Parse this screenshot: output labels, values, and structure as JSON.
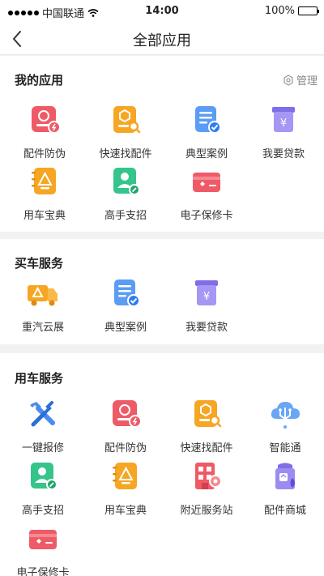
{
  "status_bar": {
    "carrier": "中国联通",
    "time": "14:00",
    "battery": "100%"
  },
  "nav": {
    "title": "全部应用"
  },
  "my_apps": {
    "title": "我的应用",
    "manage_label": "管理",
    "items": [
      {
        "label": "配件防伪",
        "icon": "part-anticounterfeit-icon"
      },
      {
        "label": "快速找配件",
        "icon": "find-parts-icon"
      },
      {
        "label": "典型案例",
        "icon": "cases-icon"
      },
      {
        "label": "我要贷款",
        "icon": "loan-icon"
      },
      {
        "label": "用车宝典",
        "icon": "guide-book-icon"
      },
      {
        "label": "高手支招",
        "icon": "expert-tips-icon"
      },
      {
        "label": "电子保修卡",
        "icon": "warranty-card-icon"
      }
    ]
  },
  "buy_service": {
    "title": "买车服务",
    "items": [
      {
        "label": "重汽云展",
        "icon": "truck-expo-icon"
      },
      {
        "label": "典型案例",
        "icon": "cases-icon"
      },
      {
        "label": "我要贷款",
        "icon": "loan-icon"
      }
    ]
  },
  "use_service": {
    "title": "用车服务",
    "items": [
      {
        "label": "一键报修",
        "icon": "repair-tools-icon"
      },
      {
        "label": "配件防伪",
        "icon": "part-anticounterfeit-icon"
      },
      {
        "label": "快速找配件",
        "icon": "find-parts-icon"
      },
      {
        "label": "智能通",
        "icon": "smart-cloud-icon"
      },
      {
        "label": "高手支招",
        "icon": "expert-tips-icon"
      },
      {
        "label": "用车宝典",
        "icon": "guide-book-icon"
      },
      {
        "label": "附近服务站",
        "icon": "nearby-station-icon"
      },
      {
        "label": "配件商城",
        "icon": "parts-mall-icon"
      },
      {
        "label": "电子保修卡",
        "icon": "warranty-card-icon"
      }
    ]
  },
  "colors": {
    "red": "#ef5a67",
    "orange": "#f6a623",
    "blue": "#5b9cf5",
    "purple": "#9b8cf0",
    "green": "#35c58b"
  }
}
